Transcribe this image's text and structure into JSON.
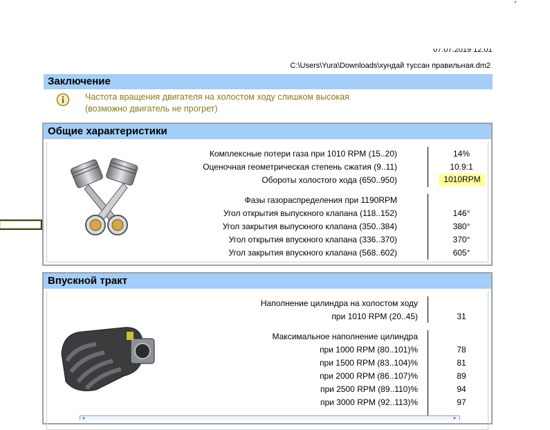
{
  "meta": {
    "datetime": "07.07.2019 12:01",
    "file_path": "C:\\Users\\Yura\\Downloads\\хундай туссан правильная.dm2"
  },
  "conclusion": {
    "title": "Заключение",
    "icon": "info-icon",
    "line1": "Частота вращения двигателя на холостом ходу слишком высокая",
    "line2": "(возможно двигатель не прогрет)"
  },
  "general": {
    "title": "Общие характеристики",
    "image": "pistons-icon",
    "rows": [
      {
        "label": "Комплексные потери газа при 1010 RPM (15..20)",
        "value": "14%"
      },
      {
        "label": "Оценочная геометрическая степень сжатия (9..11)",
        "value": "10.9:1"
      },
      {
        "label": "Обороты холостого хода (650..950)",
        "value": "1010RPM"
      }
    ],
    "phases_title": "Фазы газораспределения при 1190RPM",
    "phases": [
      {
        "label": "Угол открытия выпускного клапана (118..152)",
        "value": "146°"
      },
      {
        "label": "Угол закрытия выпускного клапана (350..384)",
        "value": "380°"
      },
      {
        "label": "Угол открытия впускного клапана (336..370)",
        "value": "370°"
      },
      {
        "label": "Угол закрытия впускного клапана (568..602)",
        "value": "605°"
      }
    ]
  },
  "intake": {
    "title": "Впускной тракт",
    "image": "intake-manifold-icon",
    "fill_title": "Наполнение цилиндра на холостом ходу",
    "fill_label": "при 1010 RPM (20..45)",
    "fill_value": "31",
    "max_title": "Максимальное наполнение цилиндра",
    "max_rows": [
      {
        "label": "при  1000 RPM (80..101)%",
        "value": "78"
      },
      {
        "label": "при  1500 RPM (83..104)%",
        "value": "81"
      },
      {
        "label": "при  2000 RPM (86..107)%",
        "value": "89"
      },
      {
        "label": "при  2500 RPM (89..110)%",
        "value": "94"
      },
      {
        "label": "при  3000 RPM (92..113)%",
        "value": "97"
      }
    ]
  }
}
